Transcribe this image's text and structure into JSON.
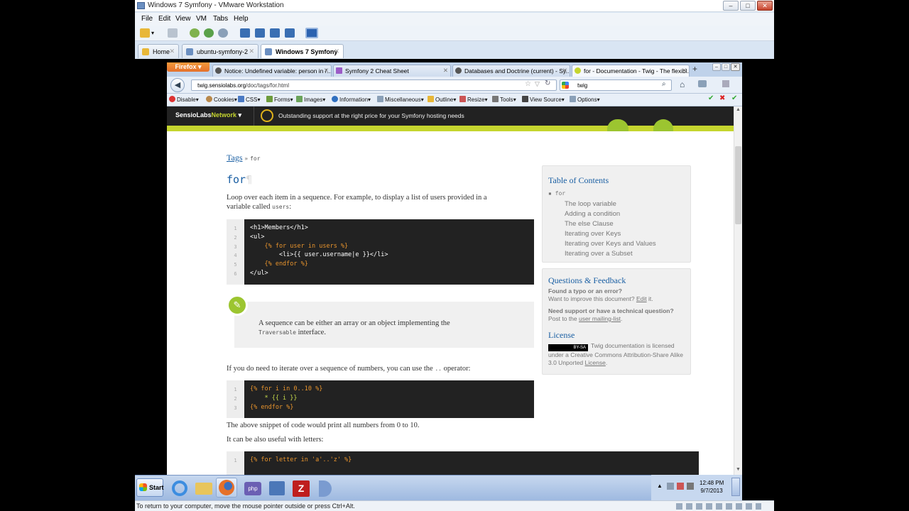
{
  "vmware": {
    "title": "Windows 7 Symfony - VMware Workstation",
    "menu": [
      "File",
      "Edit",
      "View",
      "VM",
      "Tabs",
      "Help"
    ],
    "tabs": [
      {
        "label": "Home",
        "active": false
      },
      {
        "label": "ubuntu-symfony-2",
        "active": false
      },
      {
        "label": "Windows 7 Symfony",
        "active": true
      }
    ],
    "status": "To return to your computer, move the mouse pointer outside or press Ctrl+Alt."
  },
  "firefox": {
    "button": "Firefox",
    "tabs": [
      {
        "label": "Notice: Undefined variable: person in /..."
      },
      {
        "label": "Symfony 2 Cheat Sheet"
      },
      {
        "label": "Databases and Doctrine (current) - Sy..."
      },
      {
        "label": "for - Documentation - Twig - The flexibl..."
      }
    ],
    "new_tab": "+",
    "url_host": "twig.sensiolabs.org",
    "url_path": "/doc/tags/for.html",
    "search_value": "twig",
    "webdev": [
      "Disable",
      "Cookies",
      "CSS",
      "Forms",
      "Images",
      "Information",
      "Miscellaneous",
      "Outline",
      "Resize",
      "Tools",
      "View Source",
      "Options"
    ]
  },
  "sensio": {
    "brand_a": "SensioLabs",
    "brand_b": "Network",
    "promo": "Outstanding support at the right price for your Symfony hosting needs"
  },
  "page": {
    "breadcrumb_link": "Tags",
    "breadcrumb_sep": "»",
    "breadcrumb_current": "for",
    "title": "for",
    "pilcrow": "¶",
    "intro_1": "Loop over each item in a sequence. For example, to display a list of users provided in a",
    "intro_2a": "variable called ",
    "intro_2b": "users",
    "intro_2c": ":",
    "code1_lines": [
      "1",
      "2",
      "3",
      "4",
      "5",
      "6"
    ],
    "code1": [
      "<h1>Members</h1>",
      "<ul>",
      "    {% for user in users %}",
      "        <li>{{ user.username|e }}</li>",
      "    {% endfor %}",
      "</ul>"
    ],
    "note_1": "A sequence can be either an array or an object implementing the",
    "note_2a": "Traversable",
    "note_2b": " interface.",
    "range_text_a": "If you do need to iterate over a sequence of numbers, you can use the ",
    "range_text_b": "..",
    "range_text_c": " operator:",
    "code2_lines": [
      "1",
      "2",
      "3"
    ],
    "code2": [
      "{% for i in 0..10 %}",
      "    * {{ i }}",
      "{% endfor %}"
    ],
    "after_1": "The above snippet of code would print all numbers from 0 to 10.",
    "after_2": "It can be also useful with letters:",
    "code3_lines": [
      "1"
    ],
    "code3": [
      "{% for letter in 'a'..'z' %}"
    ]
  },
  "sidebar": {
    "toc_title": "Table of Contents",
    "toc_root": "for",
    "toc_items": [
      "The loop variable",
      "Adding a condition",
      "The else Clause",
      "Iterating over Keys",
      "Iterating over Keys and Values",
      "Iterating over a Subset"
    ],
    "qf_title": "Questions & Feedback",
    "qf_1": "Found a typo or an error?",
    "qf_2a": "Want to improve this document? ",
    "qf_2b": "Edit",
    "qf_2c": " it.",
    "qf_3": "Need support or have a technical question?",
    "qf_4a": "Post to the ",
    "qf_4b": "user mailing-list",
    "qf_4c": ".",
    "lic_title": "License",
    "lic_badge": "BY-SA",
    "lic_1": "Twig documentation is licensed",
    "lic_2": "under a Creative Commons Attribution-Share Alike",
    "lic_3a": "3.0 Unported ",
    "lic_3b": "License",
    "lic_3c": "."
  },
  "taskbar": {
    "start": "Start",
    "time": "12:48 PM",
    "date": "9/7/2013"
  },
  "colors": {
    "accent": "#1a5fa3",
    "code_bg": "#222222",
    "sensio_bar": "#c5d52f",
    "firefox_orange": "#e4702b"
  }
}
